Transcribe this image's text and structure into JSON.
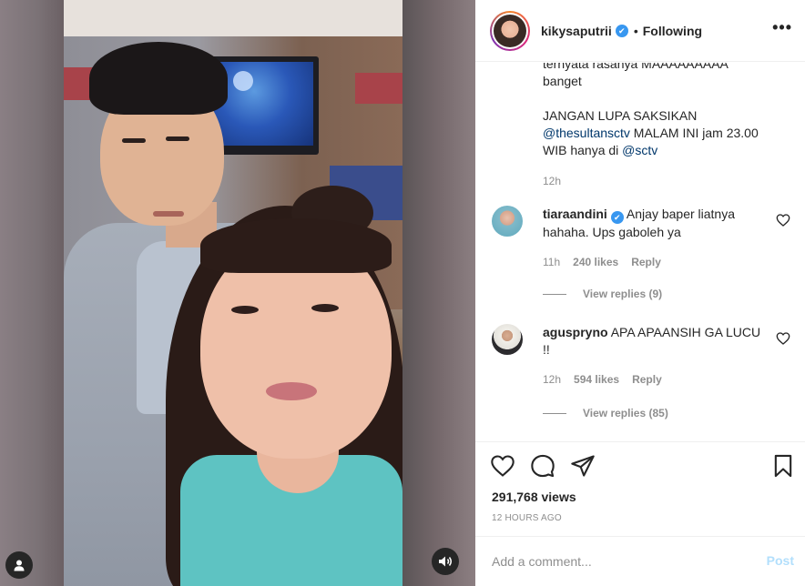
{
  "header": {
    "username": "kikysaputrii",
    "separator": "•",
    "follow_status": "Following",
    "more_label": "•••"
  },
  "caption": {
    "lines": [
      "ternyata rasanya MAAAAAAAAA",
      "banget",
      "",
      "JANGAN LUPA SAKSIKAN",
      "@thesultansctv MALAM INI jam 23.00",
      "WIB hanya di @sctv"
    ],
    "mention_1": "@thesultansctv",
    "line_5_rest": " MALAM INI jam 23.00",
    "line_6_prefix": "WIB hanya di ",
    "mention_2": "@sctv",
    "time": "12h"
  },
  "comments": [
    {
      "username": "tiaraandini",
      "verified": true,
      "text": "Anjay baper liatnya hahaha. Ups gaboleh ya",
      "time": "11h",
      "likes": "240 likes",
      "reply": "Reply",
      "view_replies": "View replies (9)"
    },
    {
      "username": "aguspryno",
      "verified": false,
      "text": "APA APAANSIH GA LUCU !!",
      "time": "12h",
      "likes": "594 likes",
      "reply": "Reply",
      "view_replies": "View replies (85)"
    }
  ],
  "stats": {
    "views": "291,768 views",
    "time_ago": "12 HOURS AGO"
  },
  "add_comment": {
    "placeholder": "Add a comment...",
    "post_label": "Post"
  },
  "icons": {
    "verified": "✔",
    "tag": "user-icon",
    "mute": "speaker-icon",
    "like": "heart-icon",
    "comment": "comment-icon",
    "share": "paper-plane-icon",
    "save": "bookmark-icon"
  },
  "colors": {
    "verified": "#3897f0",
    "mention": "#00376b",
    "muted": "#8e8e8e",
    "post_disabled": "#b2dffc"
  }
}
